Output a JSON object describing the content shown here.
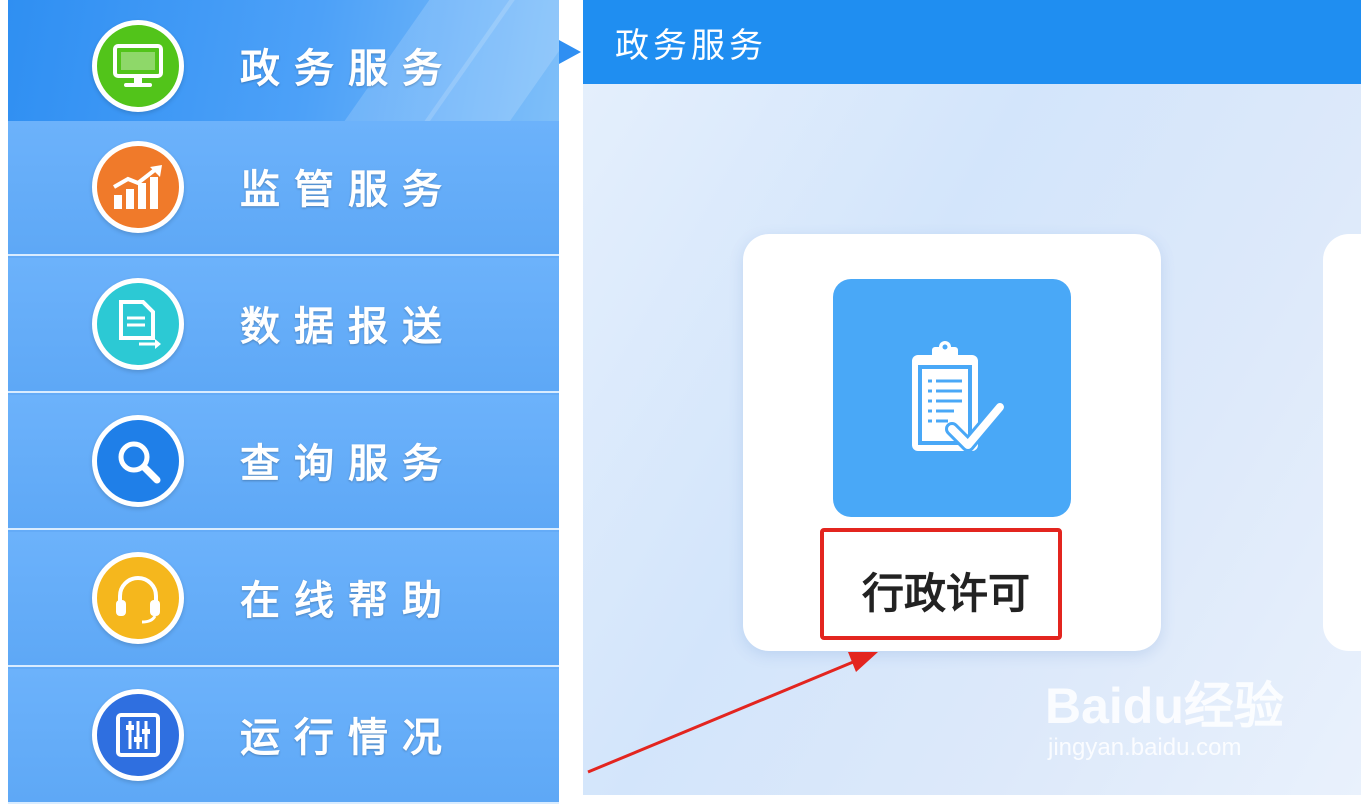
{
  "sidebar": {
    "items": [
      {
        "label": "政务服务",
        "icon": "monitor-icon",
        "color": "#52c41a",
        "active": true
      },
      {
        "label": "监管服务",
        "icon": "chart-growth-icon",
        "color": "#f07a2a",
        "active": false
      },
      {
        "label": "数据报送",
        "icon": "document-send-icon",
        "color": "#2cc9d4",
        "active": false
      },
      {
        "label": "查询服务",
        "icon": "search-icon",
        "color": "#1f7fe8",
        "active": false
      },
      {
        "label": "在线帮助",
        "icon": "headset-icon",
        "color": "#f5b71d",
        "active": false
      },
      {
        "label": "运行情况",
        "icon": "sliders-icon",
        "color": "#2f6fe0",
        "active": false
      }
    ]
  },
  "main": {
    "title": "政务服务",
    "card": {
      "label": "行政许可",
      "icon": "clipboard-check-icon"
    },
    "highlight_color": "#e3251f"
  },
  "watermark": {
    "logo": "Baidu经验",
    "url": "jingyan.baidu.com"
  }
}
